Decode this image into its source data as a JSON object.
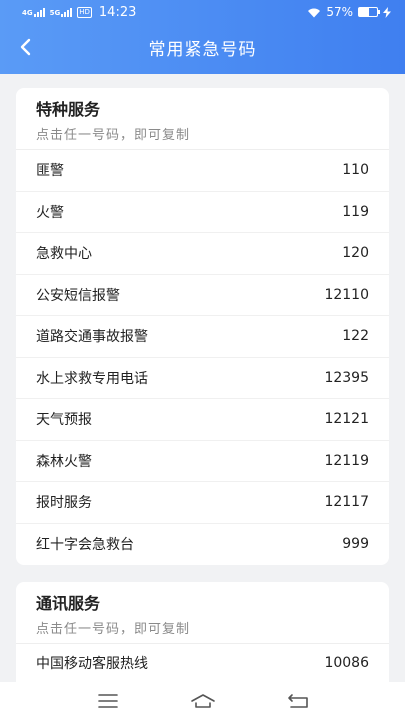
{
  "status_bar": {
    "net1": "4G",
    "net2": "5G",
    "hd": "HD",
    "time": "14:23",
    "battery_text": "57%",
    "battery_level": 0.57
  },
  "header": {
    "title": "常用紧急号码"
  },
  "sections": [
    {
      "title": "特种服务",
      "subtitle": "点击任一号码，即可复制",
      "items": [
        {
          "label": "匪警",
          "number": "110"
        },
        {
          "label": "火警",
          "number": "119"
        },
        {
          "label": "急救中心",
          "number": "120"
        },
        {
          "label": "公安短信报警",
          "number": "12110"
        },
        {
          "label": "道路交通事故报警",
          "number": "122"
        },
        {
          "label": "水上求救专用电话",
          "number": "12395"
        },
        {
          "label": "天气预报",
          "number": "12121"
        },
        {
          "label": "森林火警",
          "number": "12119"
        },
        {
          "label": "报时服务",
          "number": "12117"
        },
        {
          "label": "红十字会急救台",
          "number": "999"
        }
      ]
    },
    {
      "title": "通讯服务",
      "subtitle": "点击任一号码，即可复制",
      "items": [
        {
          "label": "中国移动客服热线",
          "number": "10086"
        }
      ]
    }
  ],
  "colors": {
    "header_start": "#5a9bf6",
    "header_end": "#3f7ff0",
    "background": "#f1f2f4"
  },
  "icons": {
    "back": "chevron-left-icon",
    "menu": "menu-icon",
    "home": "home-icon",
    "return": "return-icon"
  }
}
